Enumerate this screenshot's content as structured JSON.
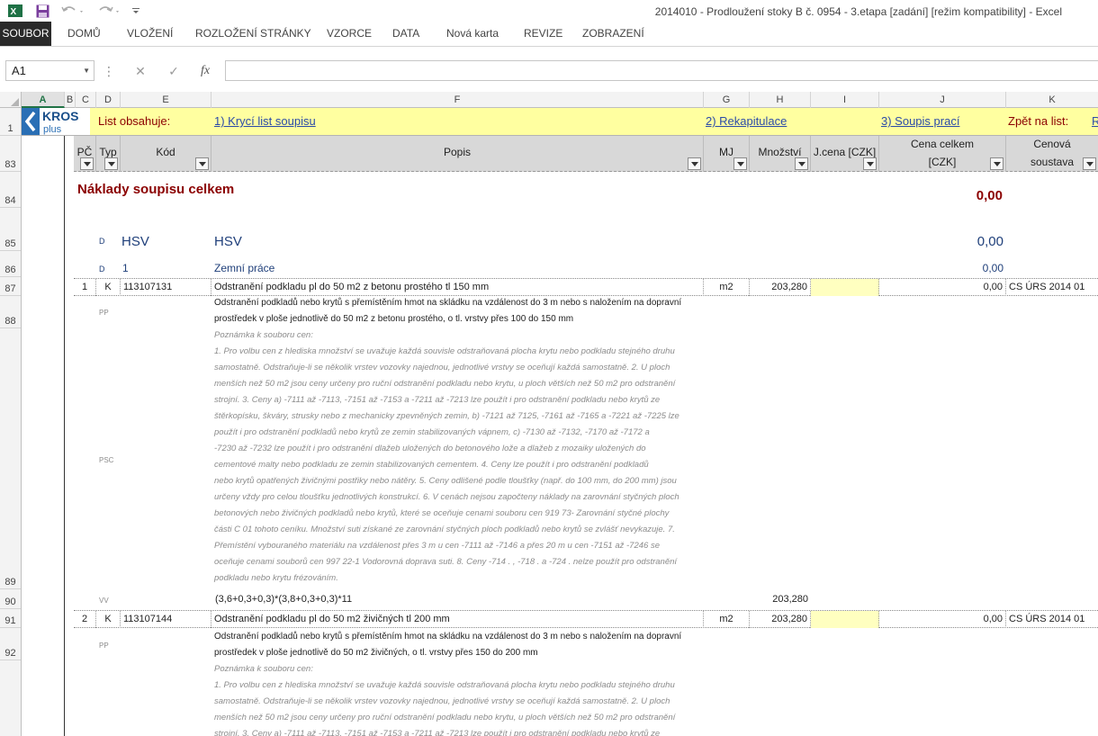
{
  "window": {
    "title": "2014010 - Prodloužení stoky B č. 0954 - 3.etapa [zadání]  [režim kompatibility] - Excel"
  },
  "ribbon": {
    "tabs": [
      "SOUBOR",
      "DOMŮ",
      "VLOŽENÍ",
      "ROZLOŽENÍ STRÁNKY",
      "VZORCE",
      "DATA",
      "Nová karta",
      "REVIZE",
      "ZOBRAZENÍ"
    ]
  },
  "formula_bar": {
    "name_box": "A1",
    "fx_label": "fx",
    "formula": ""
  },
  "columns": [
    "A",
    "B",
    "C",
    "D",
    "E",
    "F",
    "G",
    "H",
    "I",
    "J",
    "K"
  ],
  "selected_column": "A",
  "rows": [
    "1",
    "83",
    "84",
    "85",
    "86",
    "87",
    "88",
    "89",
    "90",
    "91",
    "92"
  ],
  "logo": {
    "top": "KROS",
    "bottom": "plus"
  },
  "info_row": {
    "label": "List obsahuje:",
    "link1": "1) Krycí list soupisu",
    "link2": "2) Rekapitulace",
    "link3": "3) Soupis prací",
    "back_label": "Zpět na list:",
    "back_link": "R"
  },
  "table_header": {
    "pc": "PČ",
    "typ": "Typ",
    "kod": "Kód",
    "popis": "Popis",
    "mj": "MJ",
    "mnozstvi": "Množství",
    "jcena": "J.cena [CZK]",
    "cena_celkem_1": "Cena celkem",
    "cena_celkem_2": "[CZK]",
    "soustava_1": "Cenová",
    "soustava_2": "soustava"
  },
  "summary": {
    "title": "Náklady soupisu celkem",
    "total": "0,00"
  },
  "section_hsv": {
    "type": "D",
    "code": "HSV",
    "name": "HSV",
    "total": "0,00"
  },
  "section_1": {
    "type": "D",
    "code": "1",
    "name": "Zemní práce",
    "total": "0,00"
  },
  "item1": {
    "pc": "1",
    "typ": "K",
    "kod": "113107131",
    "popis": "Odstranění podkladu pl do 50 m2 z betonu prostého tl 150 mm",
    "mj": "m2",
    "mnozstvi": "203,280",
    "cena": "0,00",
    "soustava": "CS ÚRS 2014 01",
    "pp_tag": "PP",
    "psc_tag": "PSC",
    "vv_tag": "VV",
    "pp_lines": [
      "Odstranění podkladů nebo krytů s přemístěním hmot na skládku na vzdálenost do 3 m nebo s naložením na dopravní",
      "prostředek v ploše jednotlivě do 50 m2 z betonu prostého, o tl. vrstvy přes 100 do 150 mm"
    ],
    "note_lines": [
      "Poznámka k souboru cen:",
      "1. Pro volbu cen z hlediska množství se uvažuje každá souvisle odstraňovaná plocha krytu nebo     podkladu stejného druhu",
      "samostatně. Odstraňuje-li se několik vrstev vozovky najednou, jednotlivé     vrstvy se oceňují každá samostatně. 2. U ploch",
      "menších než 50 m2 jsou ceny určeny pro ruční odstranění podkladu nebo krytu, u ploch      větších než 50 m2 pro odstranění",
      "strojní. 3. Ceny     a) -7111 až -7113, -7151 až -7153 a -7211 až -7213 lze použít i pro odstranění podkladu nebo          krytů ze",
      "štěrkopísku, škváry, strusky nebo z mechanicky zpevněných zemin,      b) -7121 až 7125, -7161 až -7165 a -7221 až -7225 lze",
      "použít i pro odstranění podkladů nebo          krytů ze zemin stabilizovaných vápnem,      c) -7130 až -7132, -7170 až -7172 a",
      "-7230 až -7232 lze použít i pro odstranění dlažeb uložených          do betonového lože a dlažeb z mozaiky uložených do",
      "cementové malty nebo podkladu ze zemin          stabilizovaných cementem. 4. Ceny lze použít i pro odstranění podkladů",
      "nebo krytů opatřených živičnými postřiky nebo nátěry. 5. Ceny odlišené podle tloušťky (např. do 100 mm, do 200 mm) jsou",
      "určeny vždy pro celou tloušťku      jednotlivých konstrukcí. 6. V cenách nejsou započteny náklady na zarovnání styčných ploch",
      "betonových nebo živičných podkladů      nebo krytů, které se oceňuje cenami souboru cen 919 73- Zarovnání styčné plochy",
      "části C 01 tohoto      ceníku. Množství suti získané ze zarovnání styčných ploch podkladů nebo krytů se zvlášť nevykazuje. 7.",
      "Přemístění vybouraného materiálu na vzdálenost přes 3 m u cen -7111 až -7146 a přes 20 m u cen      -7151 až -7246 se",
      "oceňuje cenami souborů cen 997 22-1 Vodorovná doprava suti. 8. Ceny -714 . , -718 . a -724 . nelze použít pro odstranění",
      "podkladu nebo krytu frézováním."
    ],
    "vv_formula": "(3,6+0,3+0,3)*(3,8+0,3+0,3)*11",
    "vv_value": "203,280"
  },
  "item2": {
    "pc": "2",
    "typ": "K",
    "kod": "113107144",
    "popis": "Odstranění podkladu pl do 50 m2 živičných tl 200 mm",
    "mj": "m2",
    "mnozstvi": "203,280",
    "cena": "0,00",
    "soustava": "CS ÚRS 2014 01",
    "pp_tag": "PP",
    "pp_lines": [
      "Odstranění podkladů nebo krytů s přemístěním hmot na skládku na vzdálenost do 3 m nebo s naložením na dopravní",
      "prostředek v ploše jednotlivě do 50 m2 živičných, o tl. vrstvy přes 150 do 200 mm"
    ],
    "note_lines": [
      "Poznámka k souboru cen:",
      "1. Pro volbu cen z hlediska množství se uvažuje každá souvisle odstraňovaná plocha krytu nebo     podkladu stejného druhu",
      "samostatně. Odstraňuje-li se několik vrstev vozovky najednou, jednotlivé     vrstvy se oceňují každá samostatně. 2. U ploch",
      "menších než 50 m2 jsou ceny určeny pro ruční odstranění podkladu nebo krytu, u ploch      větších než 50 m2 pro odstranění",
      "strojní. 3. Ceny     a) -7111 až -7113, -7151 až -7153 a -7211 až -7213 lze použít i pro odstranění podkladu nebo          krytů ze"
    ]
  }
}
